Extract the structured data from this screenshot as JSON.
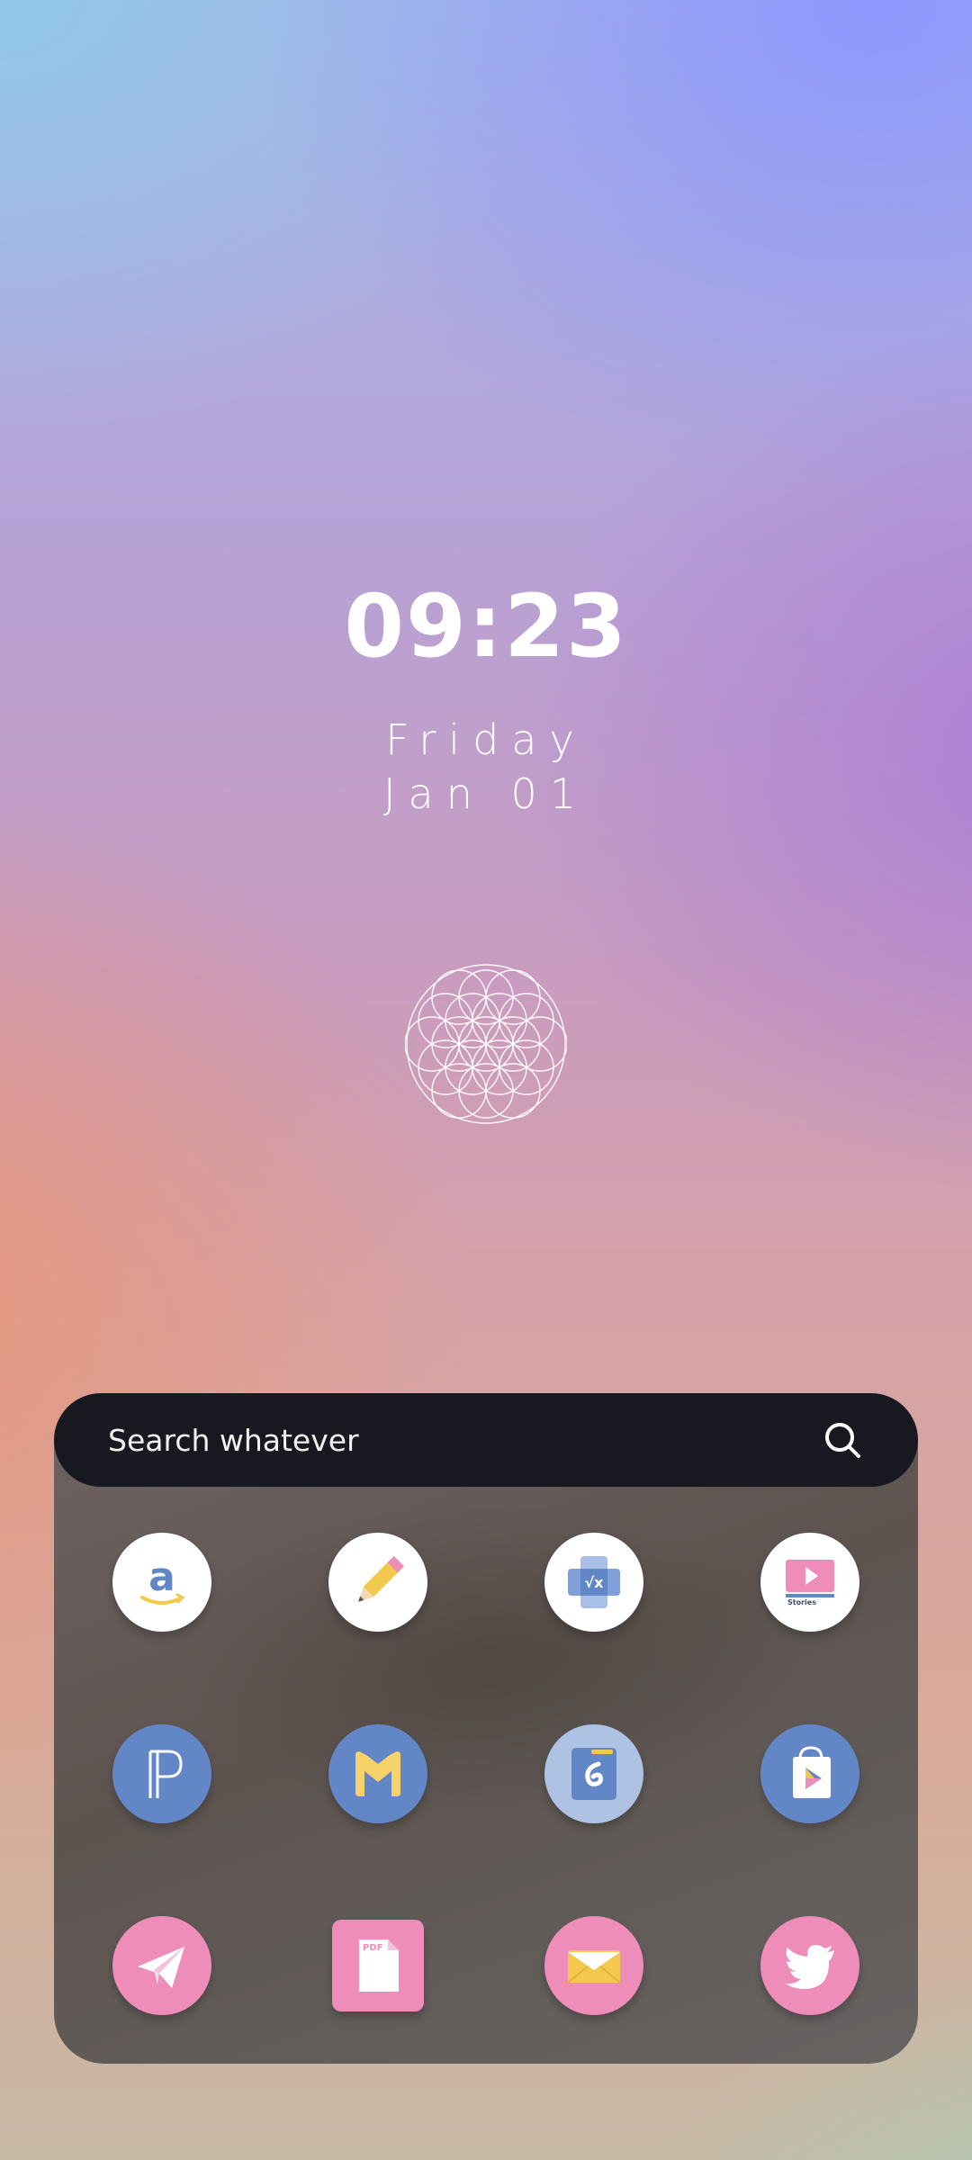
{
  "clock": {
    "time": "09:23",
    "day": "Friday",
    "date": "Jan 01"
  },
  "search": {
    "placeholder": "Search whatever"
  },
  "apps": {
    "row1": [
      "amazon-icon",
      "pencil-icon",
      "calculator-icon",
      "stories-icon"
    ],
    "row2": [
      "p-app-icon",
      "m-app-icon",
      "storage-app-icon",
      "play-store-icon"
    ],
    "row3": [
      "telegram-icon",
      "pdf-icon",
      "mail-icon",
      "twitter-icon"
    ]
  },
  "colors": {
    "icon_blue": "#6286c6",
    "icon_pink": "#ee8cba",
    "icon_white": "#ffffff",
    "search_bar": "#181920"
  }
}
